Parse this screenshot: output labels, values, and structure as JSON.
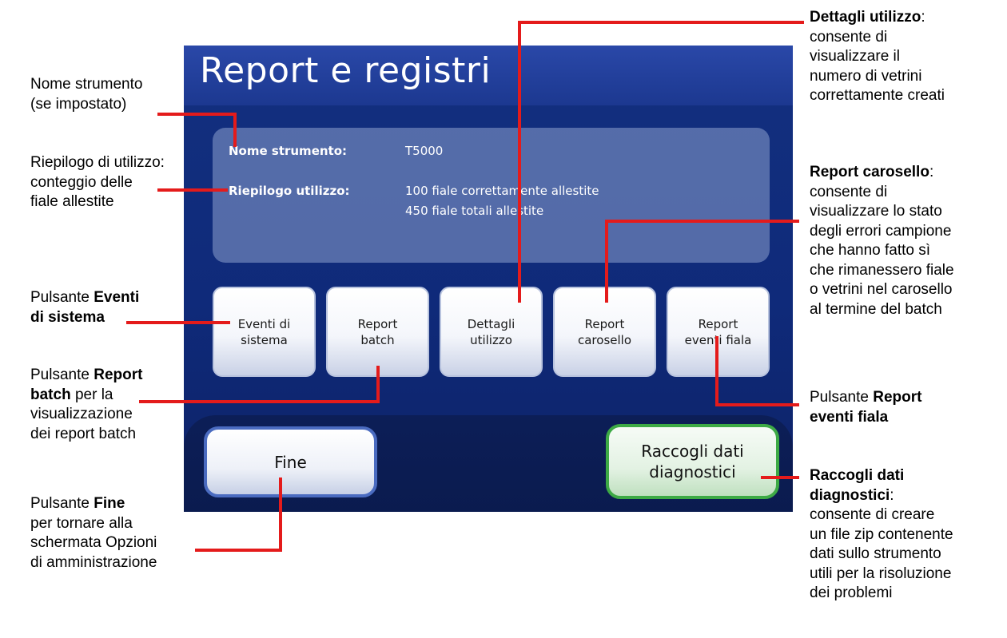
{
  "screen": {
    "title": "Report e registri",
    "summary": {
      "instrument_label": "Nome strumento:",
      "instrument_value": "T5000",
      "usage_label": "Riepilogo utilizzo:",
      "usage_line1": "100 fiale correttamente allestite",
      "usage_line2": "450 fiale totali allestite"
    },
    "buttons": {
      "system_events": "Eventi di\nsistema",
      "batch_report": "Report\nbatch",
      "usage_details": "Dettagli\nutilizzo",
      "carousel_report": "Report\ncarosello",
      "vial_events_report": "Report\neventi fiala",
      "done": "Fine",
      "collect_diagnostics": "Raccogli dati\ndiagnostici"
    }
  },
  "callouts": {
    "instrument_name": [
      "Nome strumento",
      "(se impostato)"
    ],
    "usage_summary": [
      "Riepilogo di utilizzo:",
      "conteggio delle",
      "fiale allestite"
    ],
    "system_events": {
      "pre": "Pulsante ",
      "bold1": "Eventi",
      "bold2": "di sistema"
    },
    "batch_report": {
      "pre": "Pulsante ",
      "bold1": "Report",
      "bold2": "batch",
      "post": " per la",
      "line3": "visualizzazione",
      "line4": "dei report batch"
    },
    "done": {
      "pre": "Pulsante ",
      "bold": "Fine",
      "line2": "per tornare alla",
      "line3": "schermata Opzioni",
      "line4": "di amministrazione"
    },
    "usage_details": {
      "bold": "Dettagli utilizzo",
      "post": ":",
      "lines": [
        "consente di",
        "visualizzare il",
        "numero di vetrini",
        "correttamente creati"
      ]
    },
    "carousel_report": {
      "bold": "Report carosello",
      "post": ":",
      "lines": [
        "consente di",
        "visualizzare lo stato",
        "degli errori campione",
        "che hanno fatto sì",
        "che rimanessero fiale",
        "o vetrini nel carosello",
        "al termine del batch"
      ]
    },
    "vial_events": {
      "pre": "Pulsante ",
      "bold1": "Report",
      "bold2": "eventi fiala"
    },
    "diagnostics": {
      "bold1": "Raccogli dati",
      "bold2": "diagnostici",
      "post": ":",
      "lines": [
        "consente di creare",
        "un file zip contenente",
        "dati sullo strumento",
        "utili per la risoluzione",
        "dei problemi"
      ]
    }
  },
  "colors": {
    "callout_line": "#e41b1b",
    "screen_background": "#13307f",
    "diagnostics_border": "#3daa45",
    "done_border": "#4a6bc0"
  }
}
